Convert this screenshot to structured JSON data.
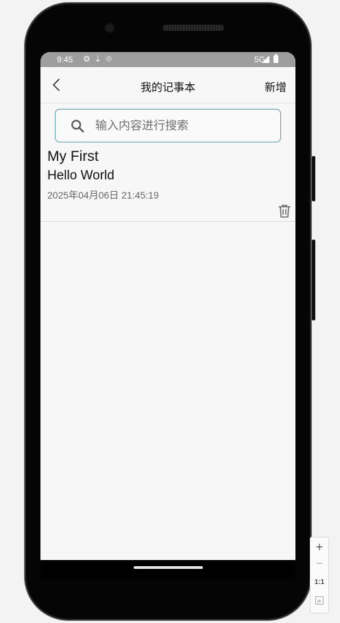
{
  "statusbar": {
    "time": "9:45",
    "icons": [
      "gear-icon",
      "download-icon",
      "cast-icon"
    ],
    "network": "5G"
  },
  "appbar": {
    "title": "我的记事本",
    "add_label": "新增"
  },
  "search": {
    "placeholder": "输入内容进行搜索",
    "value": ""
  },
  "notes": [
    {
      "title": "My First",
      "content": "Hello World",
      "date": "2025年04月06日 21:45:19"
    }
  ],
  "zoom_controls": {
    "zoom_in": "+",
    "zoom_out": "−",
    "actual_size": "1:1"
  },
  "colors": {
    "statusbar": "#9e9e9e",
    "background": "#f7f7f7",
    "search_border": "#5b9aa6"
  }
}
